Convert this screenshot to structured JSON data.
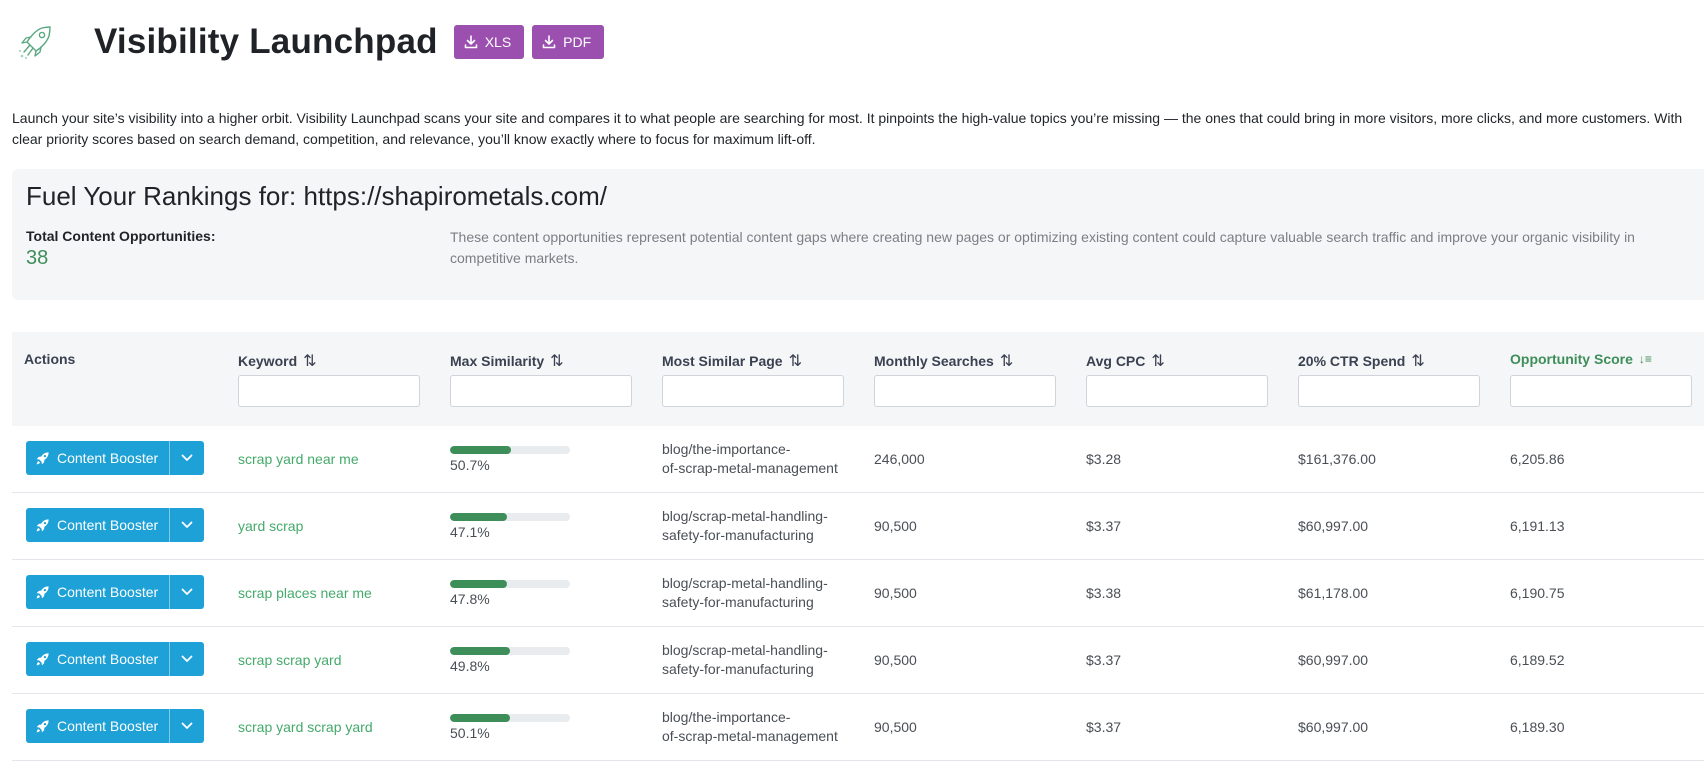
{
  "header": {
    "title": "Visibility Launchpad",
    "logo_icon": "rocket-icon",
    "buttons": [
      {
        "label": "XLS",
        "icon": "download-icon"
      },
      {
        "label": "PDF",
        "icon": "download-icon"
      }
    ]
  },
  "intro": "Launch your site’s visibility into a higher orbit. Visibility Launchpad scans your site and compares it to what people are searching for most. It pinpoints the high-value topics you’re missing — the ones that could bring in more visitors, more clicks, and more customers. With clear priority scores based on search demand, competition, and relevance, you’ll know exactly where to focus for maximum lift-off.",
  "summary": {
    "title": "Fuel Your Rankings for: https://shapirometals.com/",
    "total_label": "Total Content Opportunities:",
    "total_value": "38",
    "description": "These content opportunities represent potential content gaps where creating new pages or optimizing existing content could capture valuable search traffic and improve your organic visibility in competitive markets."
  },
  "table": {
    "columns": [
      {
        "label": "Actions",
        "sortable": false,
        "filter": false
      },
      {
        "label": "Keyword",
        "sortable": true,
        "filter": true
      },
      {
        "label": "Max Similarity",
        "sortable": true,
        "filter": true
      },
      {
        "label": "Most Similar Page",
        "sortable": true,
        "filter": true
      },
      {
        "label": "Monthly Searches",
        "sortable": true,
        "filter": true
      },
      {
        "label": "Avg CPC",
        "sortable": true,
        "filter": true
      },
      {
        "label": "20% CTR Spend",
        "sortable": true,
        "filter": true
      },
      {
        "label": "Opportunity Score",
        "sortable": true,
        "filter": true,
        "active_sort": "desc"
      }
    ],
    "action_label": "Content Booster",
    "rows": [
      {
        "keyword": "scrap yard near me",
        "similarity": "50.7%",
        "similarity_value": 0.507,
        "page": "blog/the-importance-of-scrap-metal-management",
        "searches": "246,000",
        "cpc": "$3.28",
        "spend": "$161,376.00",
        "score": "6,205.86"
      },
      {
        "keyword": "yard scrap",
        "similarity": "47.1%",
        "similarity_value": 0.471,
        "page": "blog/scrap-metal-handling-safety-for-manufacturing",
        "searches": "90,500",
        "cpc": "$3.37",
        "spend": "$60,997.00",
        "score": "6,191.13"
      },
      {
        "keyword": "scrap places near me",
        "similarity": "47.8%",
        "similarity_value": 0.478,
        "page": "blog/scrap-metal-handling-safety-for-manufacturing",
        "searches": "90,500",
        "cpc": "$3.38",
        "spend": "$61,178.00",
        "score": "6,190.75"
      },
      {
        "keyword": "scrap scrap yard",
        "similarity": "49.8%",
        "similarity_value": 0.498,
        "page": "blog/scrap-metal-handling-safety-for-manufacturing",
        "searches": "90,500",
        "cpc": "$3.37",
        "spend": "$60,997.00",
        "score": "6,189.52"
      },
      {
        "keyword": "scrap yard scrap yard",
        "similarity": "50.1%",
        "similarity_value": 0.501,
        "page": "blog/the-importance-of-scrap-metal-management",
        "searches": "90,500",
        "cpc": "$3.37",
        "spend": "$60,997.00",
        "score": "6,189.30"
      }
    ]
  },
  "colors": {
    "accent_green": "#3e8e5a",
    "keyword_green": "#44aa6a",
    "download_purple": "#9b4faf",
    "booster_blue": "#1da1d6"
  }
}
